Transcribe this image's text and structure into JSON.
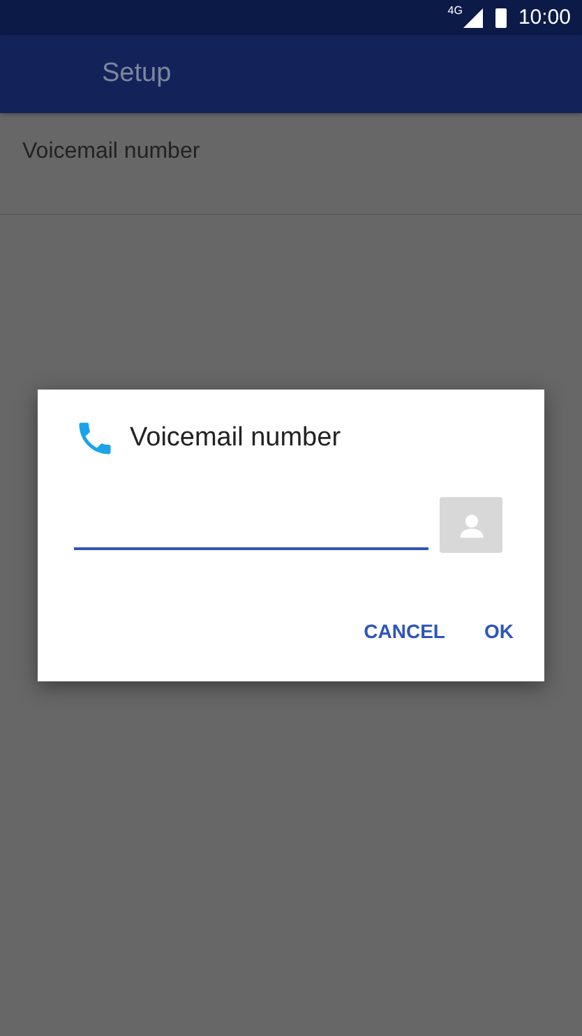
{
  "status_bar": {
    "network": "4G",
    "time": "10:00"
  },
  "app_bar": {
    "title": "Setup"
  },
  "list": [
    {
      "label": "Voicemail number"
    }
  ],
  "dialog": {
    "title": "Voicemail number",
    "field": {
      "focused": true
    },
    "buttons": [
      {
        "label": "CANCEL"
      },
      {
        "label": "OK"
      }
    ]
  }
}
